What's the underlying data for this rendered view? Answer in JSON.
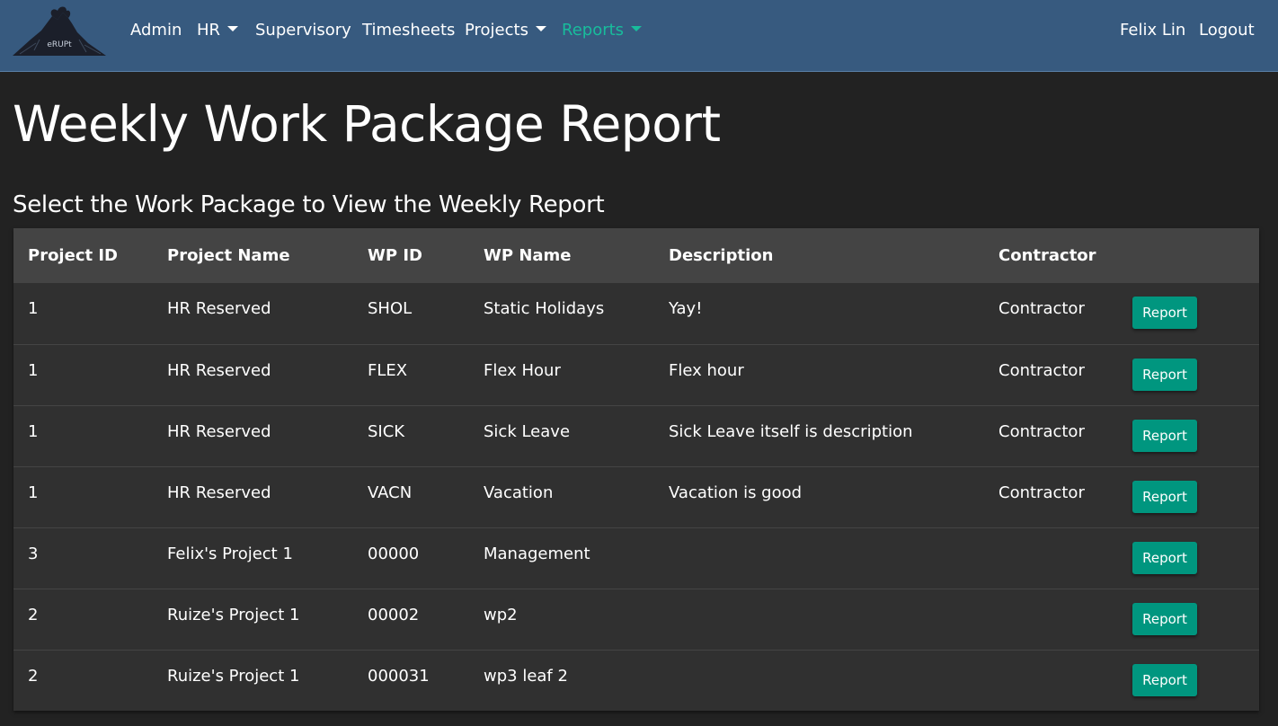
{
  "brand": {
    "logo_text": "eRUPt"
  },
  "nav": {
    "items": [
      {
        "label": "Admin",
        "dropdown": false
      },
      {
        "label": "HR",
        "dropdown": true
      },
      {
        "label": "Supervisory",
        "dropdown": false
      },
      {
        "label": "Timesheets",
        "dropdown": false
      },
      {
        "label": "Projects",
        "dropdown": true
      },
      {
        "label": "Reports",
        "dropdown": true,
        "active": true
      }
    ],
    "user": "Felix Lin",
    "logout": "Logout",
    "active_color": "#18bc9c",
    "bar_color": "#375a7f"
  },
  "page": {
    "title": "Weekly Work Package Report",
    "subtitle": "Select the Work Package to View the Weekly Report"
  },
  "table": {
    "headers": [
      "Project ID",
      "Project Name",
      "WP ID",
      "WP Name",
      "Description",
      "Contractor"
    ],
    "button_label": "Report",
    "button_color": "#00967f",
    "rows": [
      {
        "project_id": "1",
        "project_name": "HR Reserved",
        "wp_id": "SHOL",
        "wp_name": "Static Holidays",
        "description": "Yay!",
        "contractor": "Contractor"
      },
      {
        "project_id": "1",
        "project_name": "HR Reserved",
        "wp_id": "FLEX",
        "wp_name": "Flex Hour",
        "description": "Flex hour",
        "contractor": "Contractor"
      },
      {
        "project_id": "1",
        "project_name": "HR Reserved",
        "wp_id": "SICK",
        "wp_name": "Sick Leave",
        "description": "Sick Leave itself is description",
        "contractor": "Contractor"
      },
      {
        "project_id": "1",
        "project_name": "HR Reserved",
        "wp_id": "VACN",
        "wp_name": "Vacation",
        "description": "Vacation is good",
        "contractor": "Contractor"
      },
      {
        "project_id": "3",
        "project_name": "Felix's Project 1",
        "wp_id": "00000",
        "wp_name": "Management",
        "description": "",
        "contractor": ""
      },
      {
        "project_id": "2",
        "project_name": "Ruize's Project 1",
        "wp_id": "00002",
        "wp_name": "wp2",
        "description": "",
        "contractor": ""
      },
      {
        "project_id": "2",
        "project_name": "Ruize's Project 1",
        "wp_id": "000031",
        "wp_name": "wp3 leaf 2",
        "description": "",
        "contractor": ""
      }
    ]
  }
}
